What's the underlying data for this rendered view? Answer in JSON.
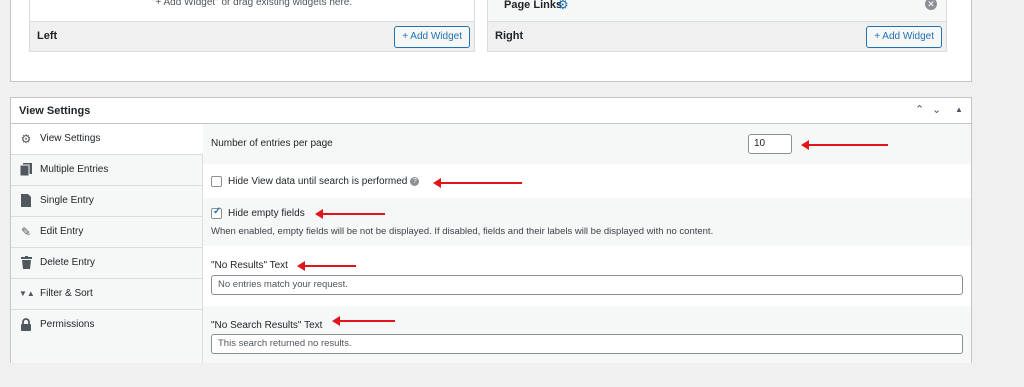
{
  "widgets": {
    "left_hint": "\"+ Add Widget\" or drag existing widgets here.",
    "left_label": "Left",
    "left_add": "+ Add Widget",
    "right_widget": "Page Links",
    "right_label": "Right",
    "right_add": "+ Add Widget"
  },
  "settings": {
    "title": "View Settings",
    "nav": [
      {
        "label": "View Settings",
        "icon": "gear-icon"
      },
      {
        "label": "Multiple Entries",
        "icon": "copy-icon"
      },
      {
        "label": "Single Entry",
        "icon": "file-icon"
      },
      {
        "label": "Edit Entry",
        "icon": "edit-icon"
      },
      {
        "label": "Delete Entry",
        "icon": "trash-icon"
      },
      {
        "label": "Filter & Sort",
        "icon": "sort-icon"
      },
      {
        "label": "Permissions",
        "icon": "lock-icon"
      }
    ],
    "entries_label": "Number of entries per page",
    "entries_value": "10",
    "hide_view_label": "Hide View data until search is performed",
    "hide_empty_label": "Hide empty fields",
    "hide_empty_desc": "When enabled, empty fields will be not be displayed. If disabled, fields and their labels will be displayed with no content.",
    "no_results_label": "\"No Results\" Text",
    "no_results_value": "No entries match your request.",
    "no_search_label": "\"No Search Results\" Text",
    "no_search_value": "This search returned no results."
  },
  "colors": {
    "accent": "#2271b1",
    "annotation": "#e0161b"
  }
}
